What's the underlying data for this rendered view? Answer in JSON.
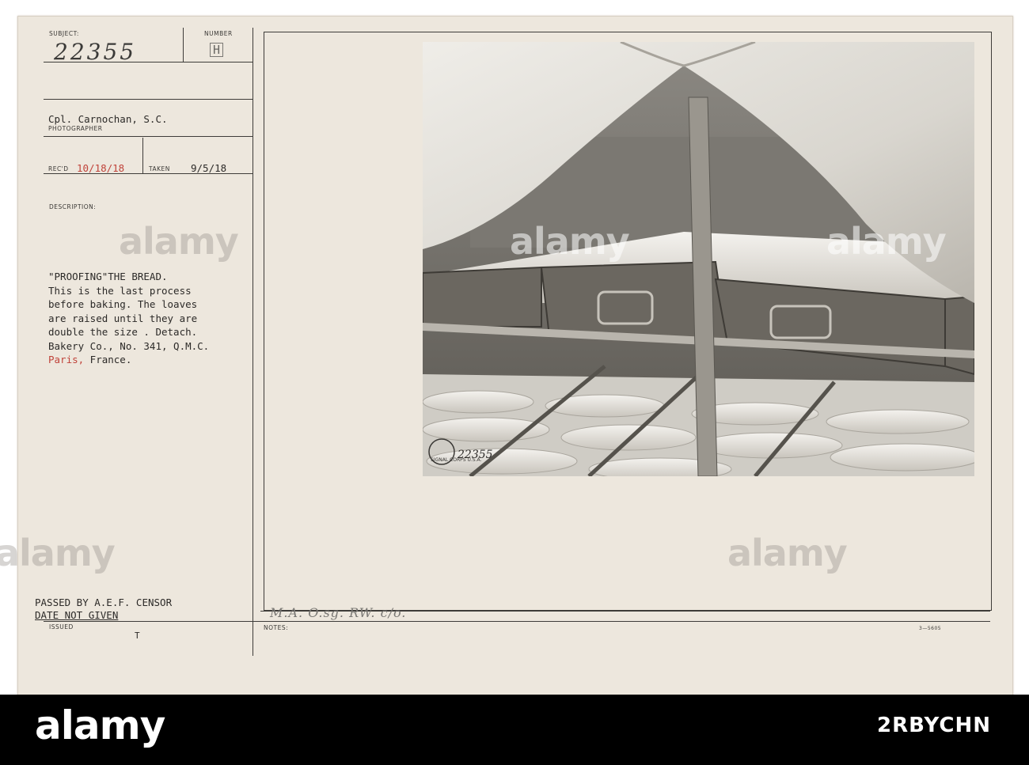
{
  "card": {
    "subject_label": "SUBJECT:",
    "subject_value": "22355",
    "number_label": "NUMBER",
    "number_value": "H",
    "photographer_value": "Cpl. Carnochan, S.C.",
    "photographer_label": "PHOTOGRAPHER",
    "recd_label": "REC'D",
    "recd_value": "10/18/18",
    "taken_label": "TAKEN",
    "taken_value": "9/5/18",
    "description_label": "DESCRIPTION:",
    "description": {
      "line1": "\"PROOFING\"THE BREAD.",
      "line2": "This is the last process",
      "line3": "before baking. The loaves",
      "line4": "are raised until they are",
      "line5": "double the size . Detach.",
      "line6": "Bakery Co., No. 341, Q.M.C.",
      "line7_place": "Paris,",
      "line7_rest": " France."
    },
    "censor_line1": "PASSED BY A.E.F. CENSOR",
    "censor_line2": "DATE NOT GIVEN",
    "issued_label": "ISSUED",
    "issued_mark": "T",
    "notes_label": "NOTES:",
    "notes_handwriting": "M.A. O.sg. RW. c/o.",
    "form_number": "3—5605",
    "photo_stamp_number": "22355",
    "photo_stamp_seal": "SIGNAL CORPS U.S.A.",
    "colors": {
      "card": "#ede7dd",
      "typed_red": "#c0433a",
      "ink": "#2c2a28"
    }
  },
  "watermarks": [
    "alamy",
    "alamy",
    "alamy",
    "alamy",
    "alamy"
  ],
  "footer": {
    "brand": "alamy",
    "image_code": "2RBYCHN"
  }
}
